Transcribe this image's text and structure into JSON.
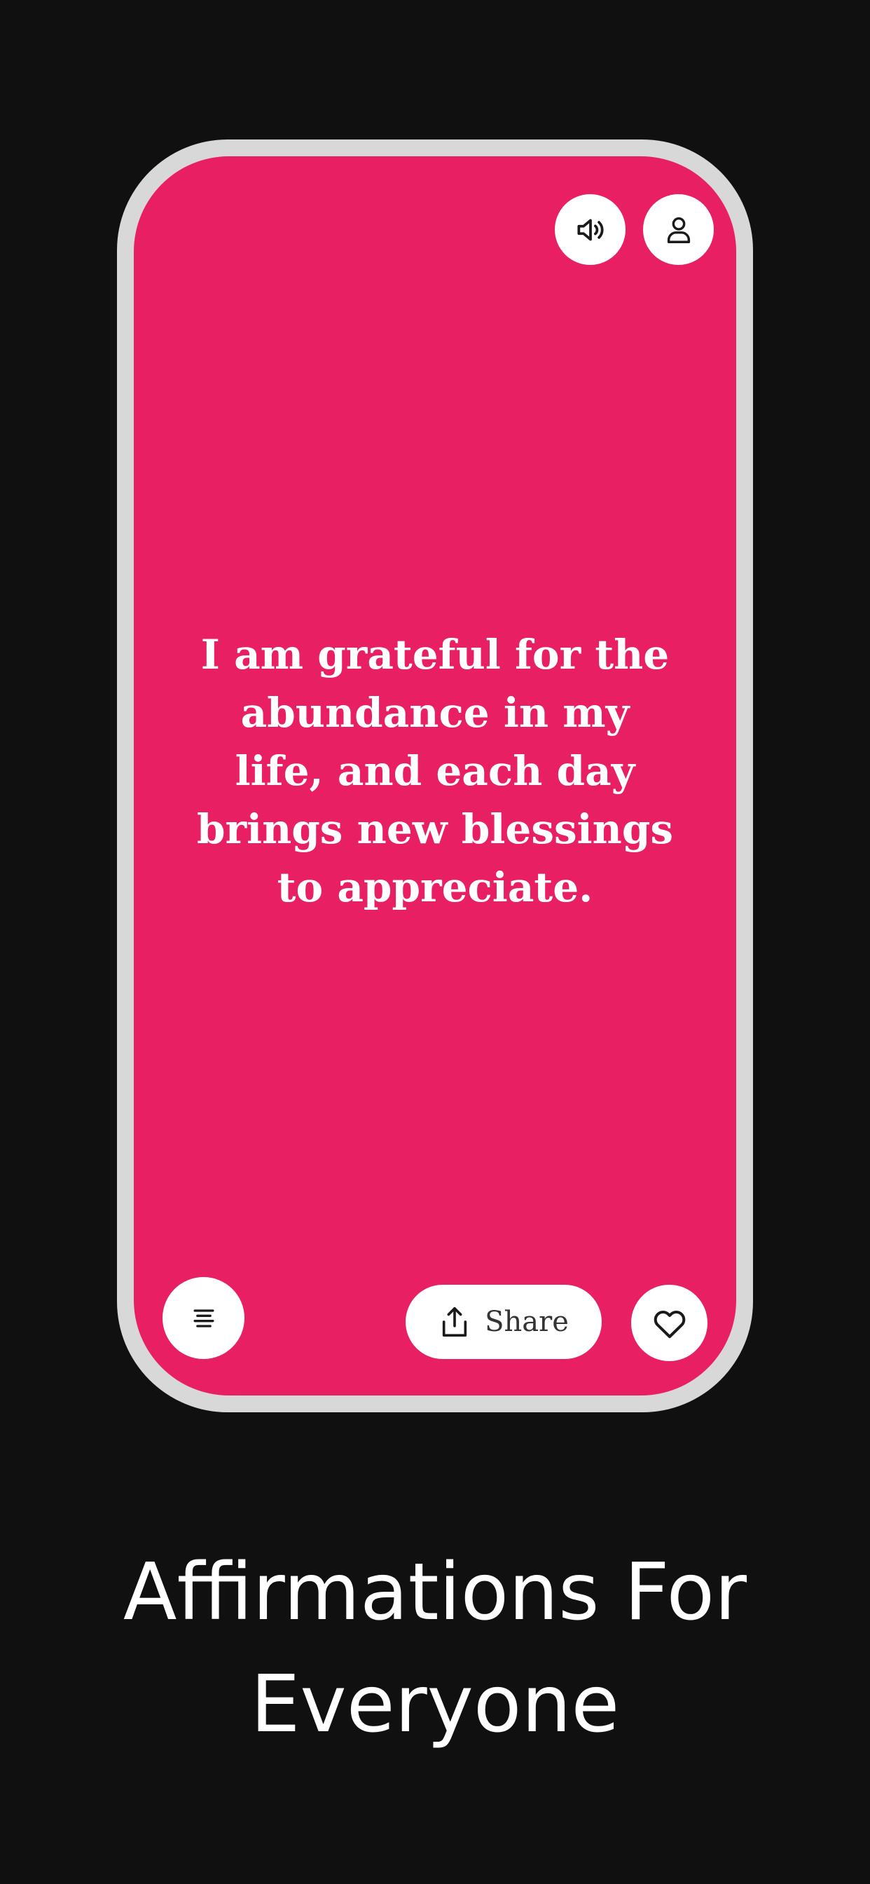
{
  "theme": {
    "background": "#101010",
    "frame": "#d8d8d8",
    "card": "#e82063",
    "button_bg": "#ffffff",
    "icon_color": "#1a1a1a"
  },
  "top_actions": [
    {
      "icon": "speaker-icon"
    },
    {
      "icon": "user-icon"
    }
  ],
  "affirmation": {
    "text": "I am grateful for the abundance in my life, and each day brings new blessings to appreciate."
  },
  "bottom_actions": {
    "menu_icon": "menu-icon",
    "share": {
      "icon": "share-icon",
      "label": "Share"
    },
    "favorite_icon": "heart-icon"
  },
  "headline": {
    "line1": "Affirmations For",
    "line2": "Everyone"
  }
}
